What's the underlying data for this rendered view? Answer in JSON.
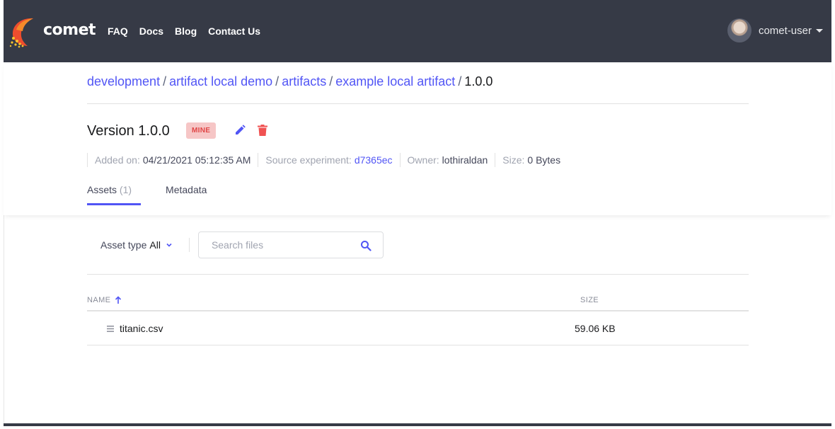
{
  "nav": {
    "brand": "comet",
    "links": [
      "FAQ",
      "Docs",
      "Blog",
      "Contact Us"
    ],
    "user": "comet-user"
  },
  "breadcrumb": {
    "items": [
      "development",
      "artifact local demo",
      "artifacts",
      "example local artifact"
    ],
    "current": "1.0.0",
    "separator": "/"
  },
  "version": {
    "title": "Version 1.0.0",
    "badge": "MINE"
  },
  "meta": {
    "added_label": "Added on:",
    "added_value": "04/21/2021 05:12:35 AM",
    "source_label": "Source experiment:",
    "source_value": "d7365ec",
    "owner_label": "Owner:",
    "owner_value": "lothiraldan",
    "size_label": "Size:",
    "size_value": "0 Bytes"
  },
  "tabs": {
    "assets_label": "Assets",
    "assets_count": "(1)",
    "metadata_label": "Metadata"
  },
  "filters": {
    "asset_type_label": "Asset type",
    "asset_type_value": "All",
    "search_placeholder": "Search files"
  },
  "table": {
    "col_name": "NAME",
    "col_size": "SIZE",
    "rows": [
      {
        "name": "titanic.csv",
        "size": "59.06 KB"
      }
    ]
  },
  "colors": {
    "nav_bg": "#363a46",
    "accent": "#5155f5",
    "badge_bg": "#f6c6c6",
    "badge_text": "#e04646",
    "delete": "#f05252"
  }
}
